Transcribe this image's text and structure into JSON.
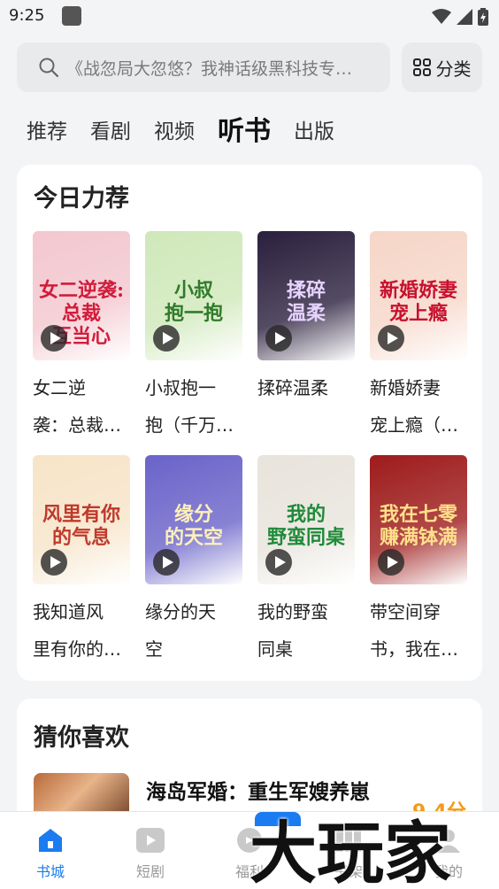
{
  "status": {
    "time": "9:25"
  },
  "search": {
    "placeholder": "《战忽局大忽悠？我神话级黑科技专…",
    "category_label": "分类"
  },
  "tabs": [
    {
      "label": "推荐"
    },
    {
      "label": "看剧"
    },
    {
      "label": "视频"
    },
    {
      "label": "听书",
      "active": true
    },
    {
      "label": "出版"
    }
  ],
  "today": {
    "title": "今日力荐",
    "books": [
      {
        "line1": "女二逆",
        "line2": "袭：总裁…",
        "cover_text": "女二逆袭:总裁\n互当心",
        "cover_bg": "#f3c7cf",
        "cover_color": "#d11c3a"
      },
      {
        "line1": "小叔抱一",
        "line2": "抱（千万…",
        "cover_text": "小叔\n抱一抱",
        "cover_bg": "#cfe8b9",
        "cover_color": "#2f7b2a"
      },
      {
        "line1": "揉碎温柔",
        "line2": "",
        "cover_text": "揉碎\n温柔",
        "cover_bg": "#2a1f3d",
        "cover_color": "#e6d3ff"
      },
      {
        "line1": "新婚娇妻",
        "line2": "宠上瘾（…",
        "cover_text": "新婚娇妻\n宠上瘾",
        "cover_bg": "#f6d6c8",
        "cover_color": "#c8102e"
      },
      {
        "line1": "我知道风",
        "line2": "里有你的…",
        "cover_text": "风里有你\n的气息",
        "cover_bg": "#f7e4c8",
        "cover_color": "#c0392b"
      },
      {
        "line1": "缘分的天",
        "line2": "空",
        "cover_text": "缘分\n的天空",
        "cover_bg": "#6a63c9",
        "cover_color": "#fff1b8"
      },
      {
        "line1": "我的野蛮",
        "line2": "同桌",
        "cover_text": "我的\n野蛮同桌",
        "cover_bg": "#e8e4dc",
        "cover_color": "#1f8a3a"
      },
      {
        "line1": "带空间穿",
        "line2": "书，我在…",
        "cover_text": "我在七零\n赚满钵满",
        "cover_bg": "#9e1b1b",
        "cover_color": "#ffe08a"
      }
    ]
  },
  "guess": {
    "title": "猜你喜欢",
    "item": {
      "title": "海岛军婚：重生军嫂养崽",
      "score": "9.4分"
    }
  },
  "nav": [
    {
      "label": "书城",
      "active": true,
      "icon": "bookstore-icon"
    },
    {
      "label": "短剧",
      "icon": "video-icon"
    },
    {
      "label": "福利",
      "icon": "gift-icon"
    },
    {
      "label": "书架",
      "icon": "bookshelf-icon"
    },
    {
      "label": "我的",
      "icon": "profile-icon"
    }
  ],
  "watermark": "大玩家",
  "colors": {
    "accent": "#1a7cf0",
    "score": "#f29a1a"
  }
}
